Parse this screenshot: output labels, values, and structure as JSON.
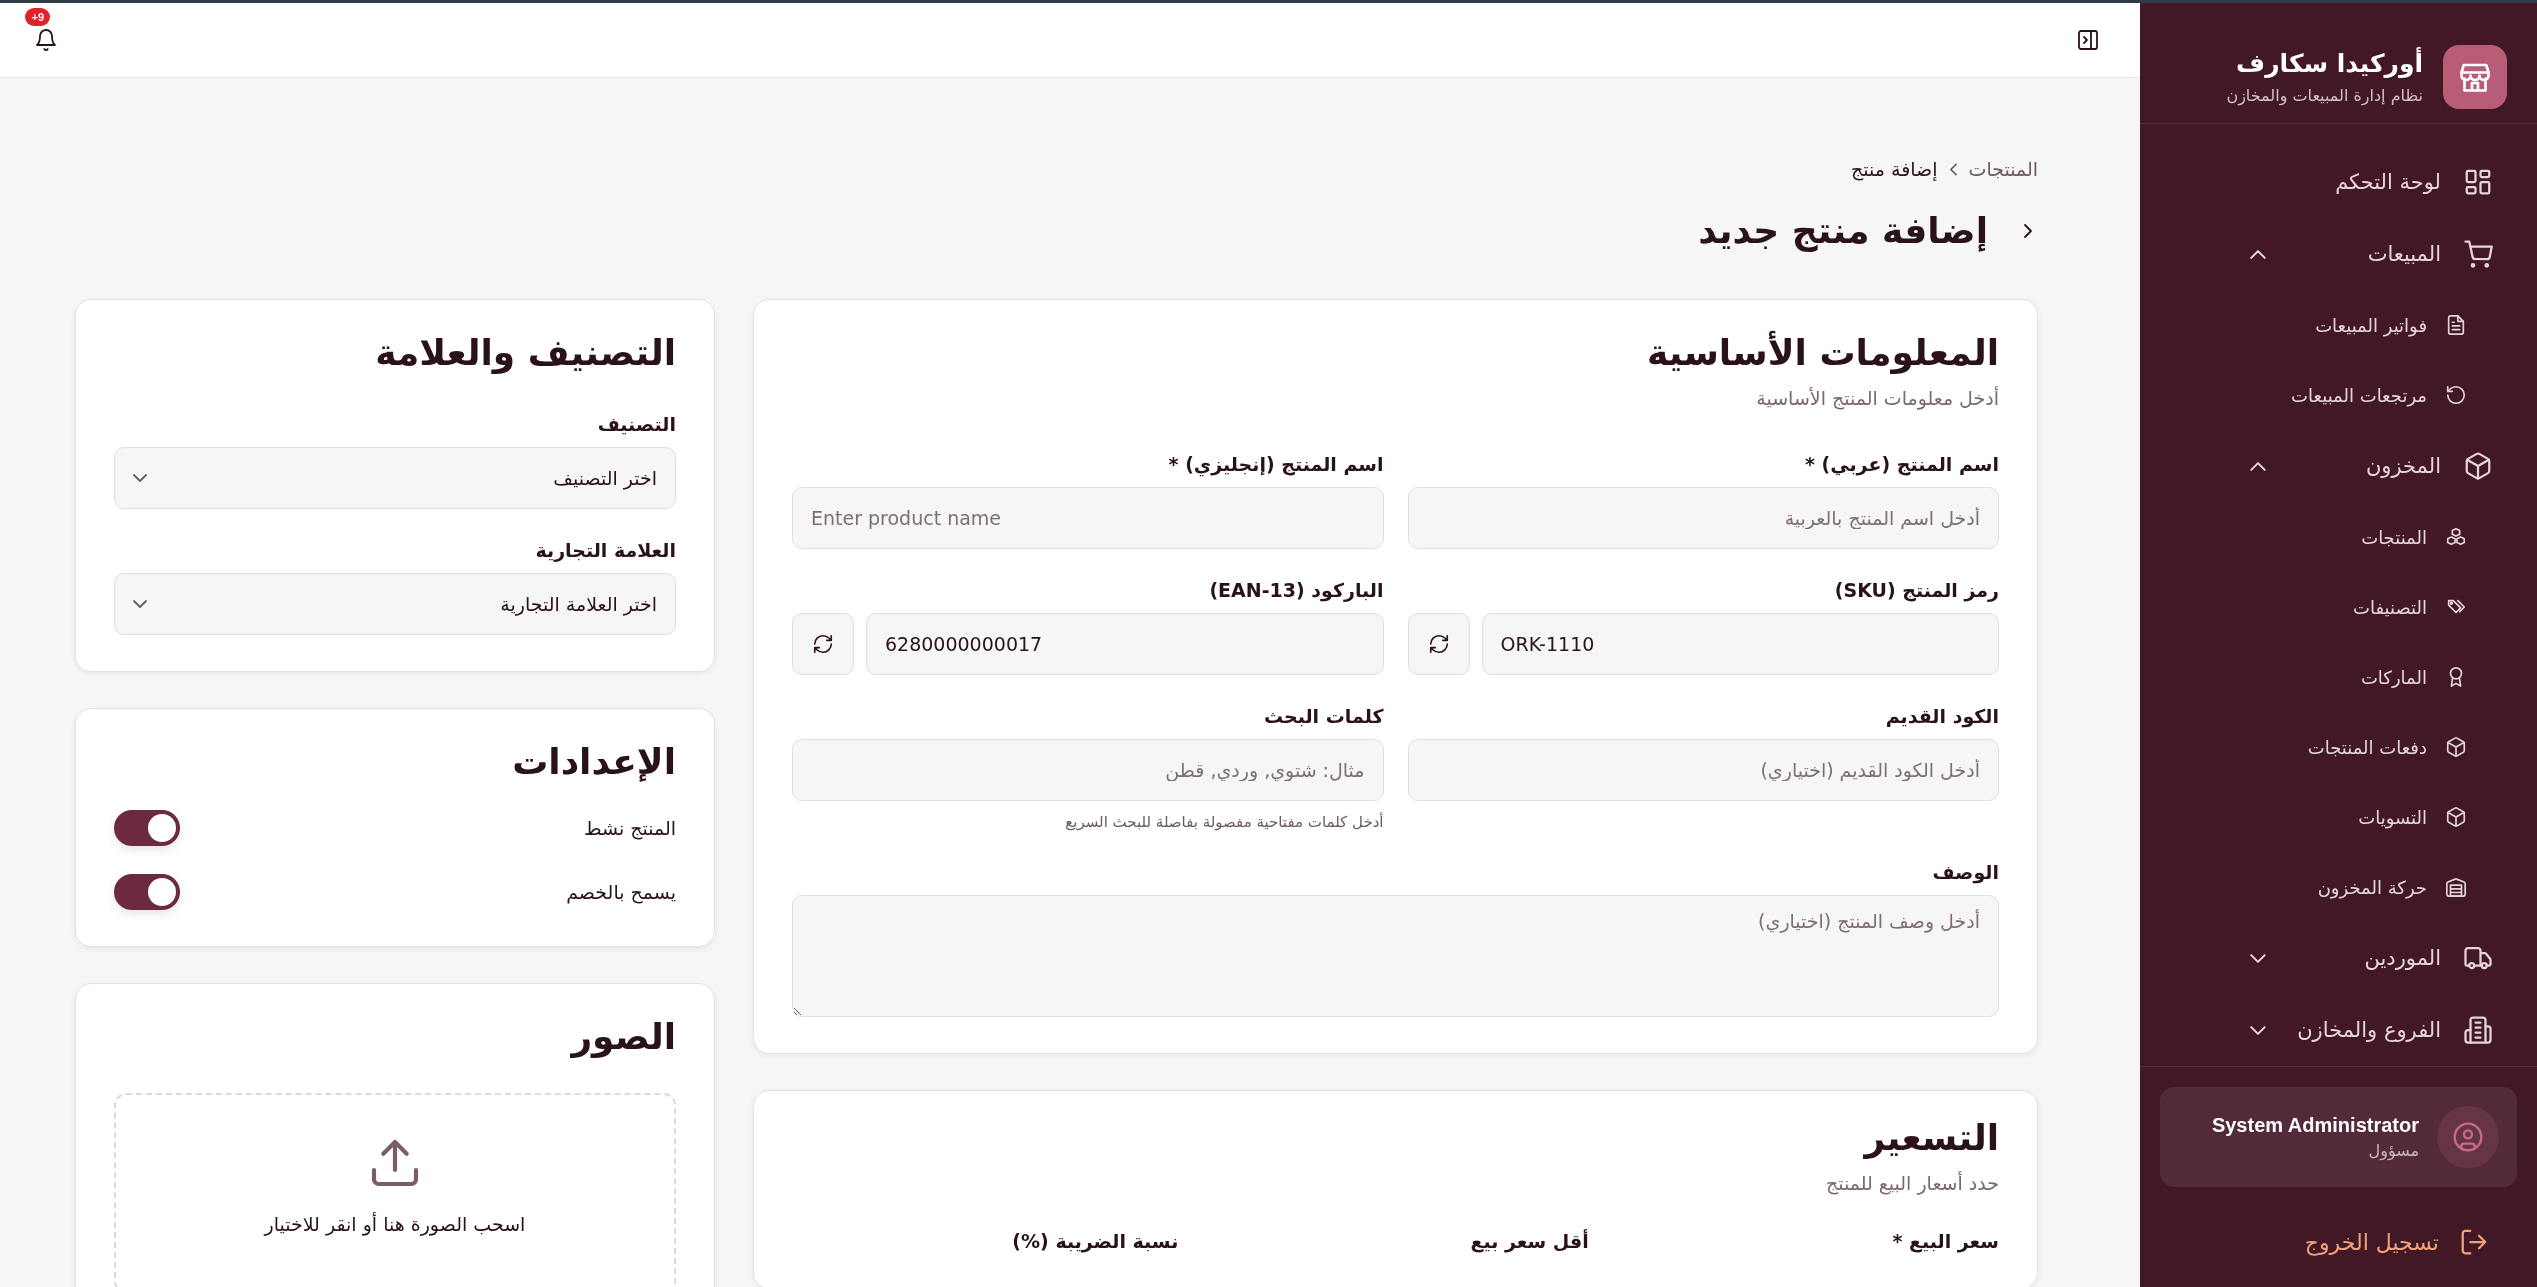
{
  "app": {
    "name": "أوركيدا سكارف",
    "subtitle": "نظام إدارة المبيعات والمخازن"
  },
  "nav": [
    {
      "label": "لوحة التحكم",
      "kind": "link"
    },
    {
      "label": "المبيعات",
      "kind": "group",
      "expanded": true,
      "children": [
        {
          "label": "فواتير المبيعات"
        },
        {
          "label": "مرتجعات المبيعات"
        }
      ]
    },
    {
      "label": "المخزون",
      "kind": "group",
      "expanded": true,
      "children": [
        {
          "label": "المنتجات"
        },
        {
          "label": "التصنيفات"
        },
        {
          "label": "الماركات"
        },
        {
          "label": "دفعات المنتجات"
        },
        {
          "label": "التسويات"
        },
        {
          "label": "حركة المخزون"
        }
      ]
    },
    {
      "label": "الموردين",
      "kind": "group",
      "expanded": false
    },
    {
      "label": "الفروع والمخازن",
      "kind": "group",
      "expanded": false
    }
  ],
  "user": {
    "name": "System Administrator",
    "role": "مسؤول"
  },
  "logout": "تسجيل الخروج",
  "header": {
    "notifications_badge": "+9"
  },
  "breadcrumb": [
    "المنتجات",
    "إضافة منتج"
  ],
  "page_title": "إضافة منتج جديد",
  "basic_info": {
    "title": "المعلومات الأساسية",
    "subtitle": "أدخل معلومات المنتج الأساسية",
    "fields": [
      {
        "kind": "text",
        "label": "اسم المنتج (عربي) *",
        "placeholder": "أدخل اسم المنتج بالعربية"
      },
      {
        "kind": "text",
        "label": "اسم المنتج (إنجليزي) *",
        "placeholder": "Enter product name"
      },
      {
        "kind": "generate",
        "label": "رمز المنتج (SKU)",
        "value": "ORK-1110"
      },
      {
        "kind": "generate",
        "label": "الباركود (EAN-13)",
        "value": "6280000000017"
      },
      {
        "kind": "text",
        "label": "الكود القديم",
        "placeholder": "أدخل الكود القديم (اختياري)"
      },
      {
        "kind": "text",
        "label": "كلمات البحث",
        "placeholder": "مثال: شتوي, وردي, قطن",
        "hint": "أدخل كلمات مفتاحية مفصولة بفاصلة للبحث السريع"
      },
      {
        "kind": "textarea",
        "label": "الوصف",
        "placeholder": "أدخل وصف المنتج (اختياري)"
      }
    ]
  },
  "classification": {
    "title": "التصنيف والعلامة",
    "selects": [
      {
        "label": "التصنيف",
        "placeholder": "اختر التصنيف"
      },
      {
        "label": "العلامة التجارية",
        "placeholder": "اختر العلامة التجارية"
      }
    ]
  },
  "settings": {
    "title": "الإعدادات",
    "toggles": [
      {
        "label": "المنتج نشط",
        "on": true
      },
      {
        "label": "يسمح بالخصم",
        "on": true
      }
    ]
  },
  "images": {
    "title": "الصور",
    "upload_text": "اسحب الصورة هنا أو انقر للاختيار"
  },
  "pricing": {
    "title": "التسعير",
    "subtitle": "حدد أسعار البيع للمنتج",
    "fields": [
      "سعر البيع *",
      "أقل سعر بيع",
      "نسبة الضريبة (%)"
    ]
  }
}
